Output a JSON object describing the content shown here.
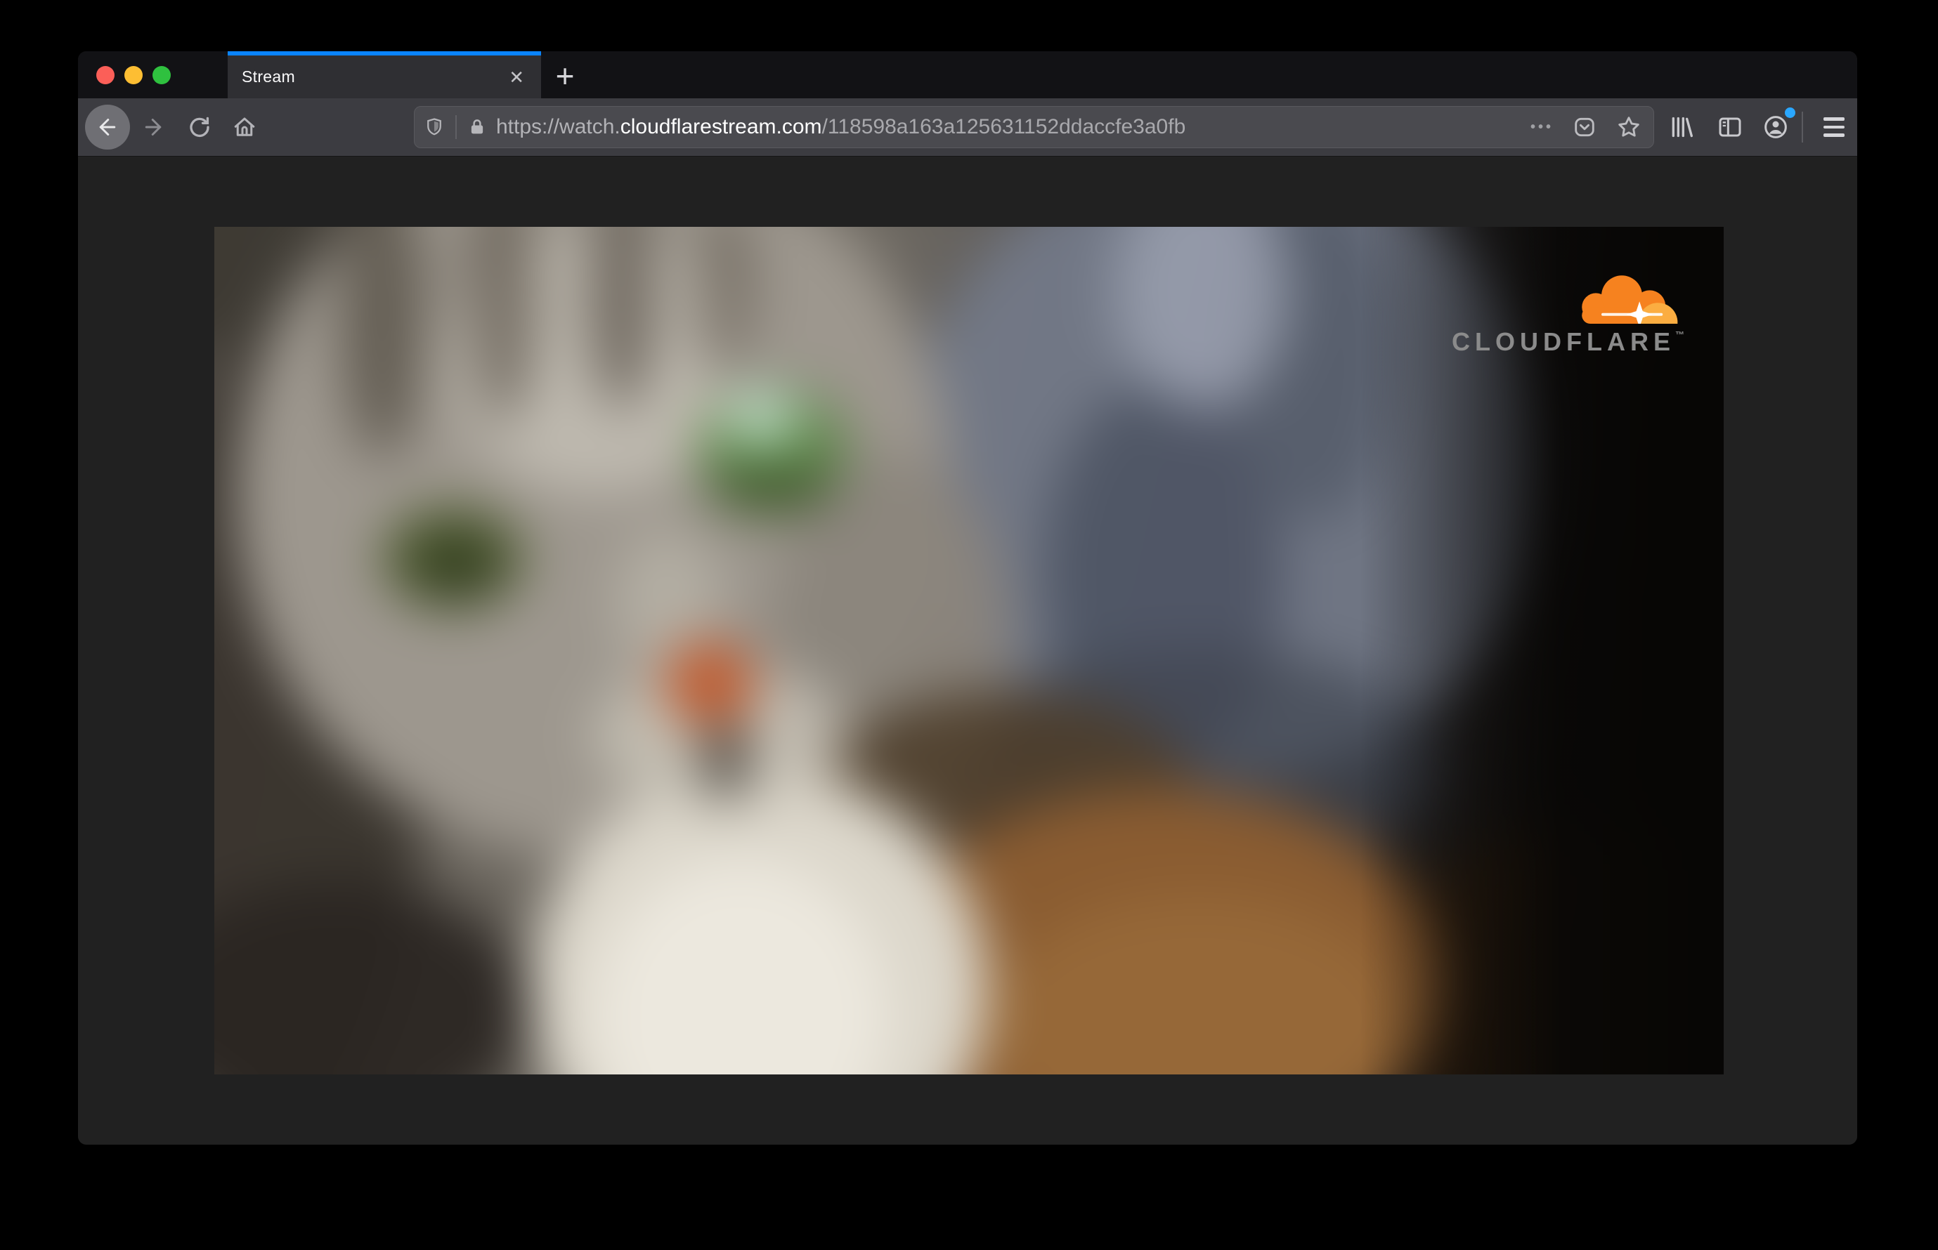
{
  "browser": {
    "tab": {
      "title": "Stream"
    },
    "url": {
      "prefix": "https://watch.",
      "domain": "cloudflarestream.com",
      "path": "/118598a163a125631152ddaccfe3a0fb"
    }
  },
  "icons": {
    "close_tab": "✕",
    "new_tab": "+",
    "page_actions": "•••"
  },
  "player": {
    "logo_text": "CLOUDFLARE",
    "logo_mark": "™"
  },
  "colors": {
    "accent_blue": "#0a84ff",
    "notification_blue": "#2aa7ff",
    "cloudflare_orange": "#f6821f",
    "cloudflare_orange_light": "#fbad41"
  }
}
